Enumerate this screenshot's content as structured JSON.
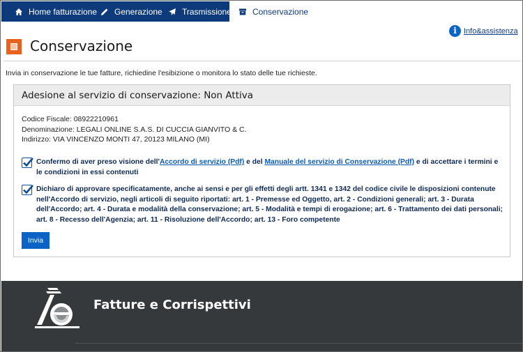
{
  "nav": {
    "tabs": [
      {
        "label": "Home fatturazione",
        "icon": "home-icon"
      },
      {
        "label": "Generazione",
        "icon": "pencil-icon"
      },
      {
        "label": "Trasmissione",
        "icon": "send-icon"
      },
      {
        "label": "Conservazione",
        "icon": "archive-icon"
      }
    ],
    "active_color": "#0d3a7a"
  },
  "header": {
    "info_link": "Info&assistenza",
    "title": "Conservazione",
    "intro": "Invia in conservazione le tue fatture, richiedine l'esibizione o monitora lo stato delle tue richieste."
  },
  "panel": {
    "title": "Adesione al servizio di conservazione: Non Attiva",
    "codice_fiscale": "Codice Fiscale: 08922210961",
    "denominazione": "Denominazione: LEGALI ONLINE S.A.S. DI CUCCIA GIANVITO & C.",
    "indirizzo": "Indirizzo: VIA VINCENZO MONTI 47, 20123 MILANO (MI)",
    "check1": {
      "checked": true,
      "text_a": "Confermo di aver preso visione dell'",
      "link1": "Accordo di servizio (Pdf)",
      "text_b": " e del ",
      "link2": "Manuale del servizio di Conservazione (Pdf)",
      "text_c": " e di accettare i termini e le condizioni in essi contenuti"
    },
    "check2": {
      "checked": true,
      "text": "Dichiaro di approvare specificatamente, anche ai sensi e per gli effetti degli artt. 1341 e 1342 del codice civile le disposizioni contenute nell'Accordo di servizio, negli articoli di seguito riportati: art. 1 - Premesse ed Oggetto, art. 2 - Condizioni generali; art. 3 - Durata dell'Accordo; art. 4 - Durata e modalità della conservazione; art. 5 - Modalità e tempi di erogazione; art. 6 - Trattamento dei dati personali; art. 8 - Recesso dell'Agenzia; art. 11 - Risoluzione dell'Accordo; art. 13 - Foro competente"
    },
    "submit_label": "Invia"
  },
  "footer": {
    "title": "Fatture e Corrispettivi"
  },
  "colors": {
    "primary_blue": "#0b63c5",
    "nav_blue": "#0d3a7a",
    "accent_orange": "#e8611f",
    "footer_bg": "#35393b"
  }
}
